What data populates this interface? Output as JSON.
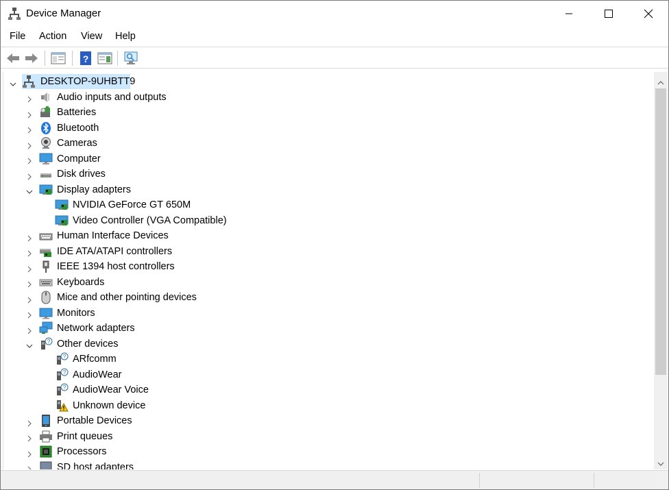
{
  "window": {
    "title": "Device Manager"
  },
  "menu": {
    "items": [
      "File",
      "Action",
      "View",
      "Help"
    ]
  },
  "toolbar": {
    "buttons": [
      "back-icon",
      "forward-icon",
      "show-hide-console-tree-icon",
      "help-icon",
      "action-pane-icon",
      "scan-hardware-icon"
    ]
  },
  "tree": {
    "root": "DESKTOP-9UHBTT9",
    "nodes": [
      {
        "label": "Audio inputs and outputs",
        "icon": "speaker-icon",
        "expanded": false
      },
      {
        "label": "Batteries",
        "icon": "battery-icon",
        "expanded": false
      },
      {
        "label": "Bluetooth",
        "icon": "bluetooth-icon",
        "expanded": false
      },
      {
        "label": "Cameras",
        "icon": "camera-icon",
        "expanded": false
      },
      {
        "label": "Computer",
        "icon": "computer-icon",
        "expanded": false
      },
      {
        "label": "Disk drives",
        "icon": "disk-drive-icon",
        "expanded": false
      },
      {
        "label": "Display adapters",
        "icon": "display-adapter-icon",
        "expanded": true
      },
      {
        "label": "NVIDIA GeForce GT 650M",
        "icon": "display-adapter-icon",
        "child": true
      },
      {
        "label": "Video Controller (VGA Compatible)",
        "icon": "display-adapter-icon",
        "child": true
      },
      {
        "label": "Human Interface Devices",
        "icon": "hid-icon",
        "expanded": false
      },
      {
        "label": "IDE ATA/ATAPI controllers",
        "icon": "ide-controller-icon",
        "expanded": false
      },
      {
        "label": "IEEE 1394 host controllers",
        "icon": "ieee1394-icon",
        "expanded": false
      },
      {
        "label": "Keyboards",
        "icon": "keyboard-icon",
        "expanded": false
      },
      {
        "label": "Mice and other pointing devices",
        "icon": "mouse-icon",
        "expanded": false
      },
      {
        "label": "Monitors",
        "icon": "monitor-icon",
        "expanded": false
      },
      {
        "label": "Network adapters",
        "icon": "network-adapter-icon",
        "expanded": false
      },
      {
        "label": "Other devices",
        "icon": "unknown-device-icon",
        "expanded": true
      },
      {
        "label": "ARfcomm",
        "icon": "unknown-device-icon",
        "child": true
      },
      {
        "label": "AudioWear",
        "icon": "unknown-device-icon",
        "child": true
      },
      {
        "label": "AudioWear Voice",
        "icon": "unknown-device-icon",
        "child": true
      },
      {
        "label": "Unknown device",
        "icon": "warning-device-icon",
        "child": true
      },
      {
        "label": "Portable Devices",
        "icon": "portable-device-icon",
        "expanded": false
      },
      {
        "label": "Print queues",
        "icon": "printer-icon",
        "expanded": false
      },
      {
        "label": "Processors",
        "icon": "processor-icon",
        "expanded": false
      },
      {
        "label": "SD host adapters",
        "icon": "sd-host-icon",
        "expanded": false
      }
    ]
  },
  "colors": {
    "selection": "#cce8ff",
    "accent_blue": "#1e90ff"
  }
}
